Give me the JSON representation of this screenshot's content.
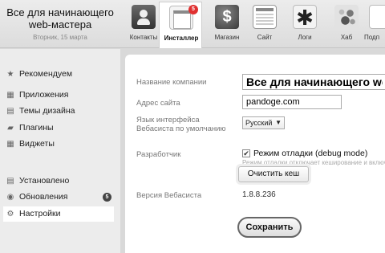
{
  "brand": {
    "title": "Все для начинающего web-мастера",
    "date": "Вторник, 15 марта"
  },
  "apps": [
    {
      "label": "Контакты",
      "icon": "contacts-icon"
    },
    {
      "label": "Инсталлер",
      "icon": "installer-icon",
      "badge": "5",
      "active": true
    },
    {
      "label": "Магазин",
      "icon": "store-icon",
      "glyph": "$"
    },
    {
      "label": "Сайт",
      "icon": "site-icon"
    },
    {
      "label": "Логи",
      "icon": "logs-icon",
      "glyph": "✱"
    },
    {
      "label": "Хаб",
      "icon": "hub-icon"
    },
    {
      "label": "Подп",
      "icon": "subscribers-icon"
    }
  ],
  "sidebar": {
    "items": [
      {
        "label": "Рекомендуем",
        "icon": "star-icon",
        "glyph": "★"
      },
      {
        "label": "Приложения",
        "icon": "apps-grid-icon",
        "glyph": "▦"
      },
      {
        "label": "Темы дизайна",
        "icon": "themes-icon",
        "glyph": "▤"
      },
      {
        "label": "Плагины",
        "icon": "plugin-icon",
        "glyph": "▰"
      },
      {
        "label": "Виджеты",
        "icon": "widgets-icon",
        "glyph": "▦"
      },
      {
        "label": "Установлено",
        "icon": "installed-icon",
        "glyph": "▤"
      },
      {
        "label": "Обновления",
        "icon": "updates-icon",
        "glyph": "◉",
        "badge": "5"
      },
      {
        "label": "Настройки",
        "icon": "settings-gear-icon",
        "glyph": "⚙",
        "active": true
      }
    ]
  },
  "settings": {
    "company_label": "Название компании",
    "company_value": "Все для начинающего web-мастера",
    "site_label": "Адрес сайта",
    "site_value": "pandoge.com",
    "language_label": "Язык интерфейса Вебасиста по умолчанию",
    "language_value": "Русский",
    "developer_label": "Разработчик",
    "debug_label": "Режим отладки (debug mode)",
    "debug_checked": true,
    "debug_hint": "Режим отладки отключает кеширование и включает",
    "clear_cache_label": "Очистить кеш",
    "version_label": "Версия Вебасиста",
    "version_value": "1.8.8.236",
    "save_label": "Сохранить"
  }
}
